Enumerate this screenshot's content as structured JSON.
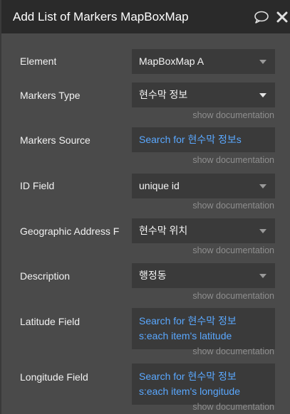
{
  "header": {
    "title": "Add List of Markers MapBoxMap",
    "icons": [
      "comment-icon",
      "close-icon"
    ]
  },
  "fields": {
    "element": {
      "label": "Element",
      "value": "MapBoxMap A"
    },
    "markers_type": {
      "label": "Markers Type",
      "value": "현수막 정보",
      "doc": "show documentation"
    },
    "markers_source": {
      "label": "Markers Source",
      "value": "Search for 현수막 정보s",
      "doc": "show documentation"
    },
    "id_field": {
      "label": "ID Field",
      "value": "unique id",
      "doc": "show documentation"
    },
    "geo_address": {
      "label": "Geographic Address F",
      "value": "현수막 위치",
      "doc": "show documentation"
    },
    "description": {
      "label": "Description",
      "value": "행정동",
      "doc": "show documentation"
    },
    "latitude": {
      "label": "Latitude Field",
      "line1": "Search for 현수막 정보",
      "line2": "s:each item's latitude",
      "doc": "show documentation"
    },
    "longitude": {
      "label": "Longitude Field",
      "line1": "Search for 현수막 정보",
      "line2": "s:each item's longitude",
      "doc": "show documentation"
    }
  }
}
